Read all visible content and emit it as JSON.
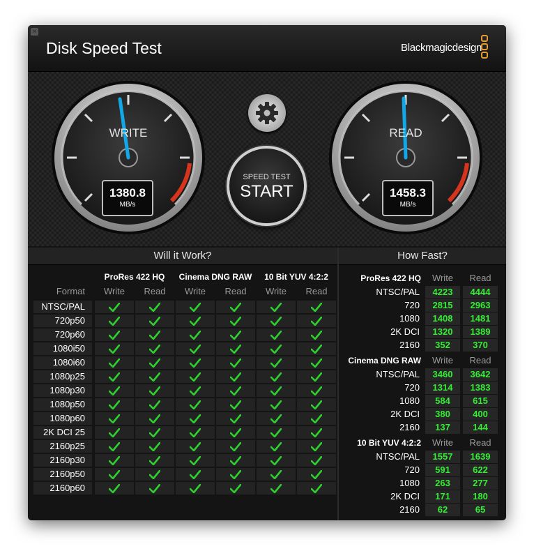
{
  "window": {
    "title": "Disk Speed Test",
    "brand": "Blackmagicdesign",
    "close_icon": "close-icon",
    "brand_color": "#e89a2e"
  },
  "gauges": {
    "write": {
      "label": "WRITE",
      "value": "1380.8",
      "unit": "MB/s"
    },
    "read": {
      "label": "READ",
      "value": "1458.3",
      "unit": "MB/s"
    },
    "needle_color": "#12a8e8"
  },
  "buttons": {
    "settings_icon": "gear-icon",
    "start_top": "SPEED TEST",
    "start_label": "START"
  },
  "will_it_work": {
    "title": "Will it Work?",
    "format_label": "Format",
    "groups": [
      "ProRes 422 HQ",
      "Cinema DNG RAW",
      "10 Bit YUV 4:2:2"
    ],
    "sub_headers": [
      "Write",
      "Read"
    ],
    "rows": [
      "NTSC/PAL",
      "720p50",
      "720p60",
      "1080i50",
      "1080i60",
      "1080p25",
      "1080p30",
      "1080p50",
      "1080p60",
      "2K DCI 25",
      "2160p25",
      "2160p30",
      "2160p50",
      "2160p60"
    ],
    "check_icon": "check-icon",
    "check_color": "#2fcf2f"
  },
  "how_fast": {
    "title": "How Fast?",
    "sub_headers": [
      "Write",
      "Read"
    ],
    "value_color": "#33ee33",
    "groups": [
      {
        "name": "ProRes 422 HQ",
        "rows": [
          {
            "label": "NTSC/PAL",
            "write": "4223",
            "read": "4444"
          },
          {
            "label": "720",
            "write": "2815",
            "read": "2963"
          },
          {
            "label": "1080",
            "write": "1408",
            "read": "1481"
          },
          {
            "label": "2K DCI",
            "write": "1320",
            "read": "1389"
          },
          {
            "label": "2160",
            "write": "352",
            "read": "370"
          }
        ]
      },
      {
        "name": "Cinema DNG RAW",
        "rows": [
          {
            "label": "NTSC/PAL",
            "write": "3460",
            "read": "3642"
          },
          {
            "label": "720",
            "write": "1314",
            "read": "1383"
          },
          {
            "label": "1080",
            "write": "584",
            "read": "615"
          },
          {
            "label": "2K DCI",
            "write": "380",
            "read": "400"
          },
          {
            "label": "2160",
            "write": "137",
            "read": "144"
          }
        ]
      },
      {
        "name": "10 Bit YUV 4:2:2",
        "rows": [
          {
            "label": "NTSC/PAL",
            "write": "1557",
            "read": "1639"
          },
          {
            "label": "720",
            "write": "591",
            "read": "622"
          },
          {
            "label": "1080",
            "write": "263",
            "read": "277"
          },
          {
            "label": "2K DCI",
            "write": "171",
            "read": "180"
          },
          {
            "label": "2160",
            "write": "62",
            "read": "65"
          }
        ]
      }
    ]
  }
}
